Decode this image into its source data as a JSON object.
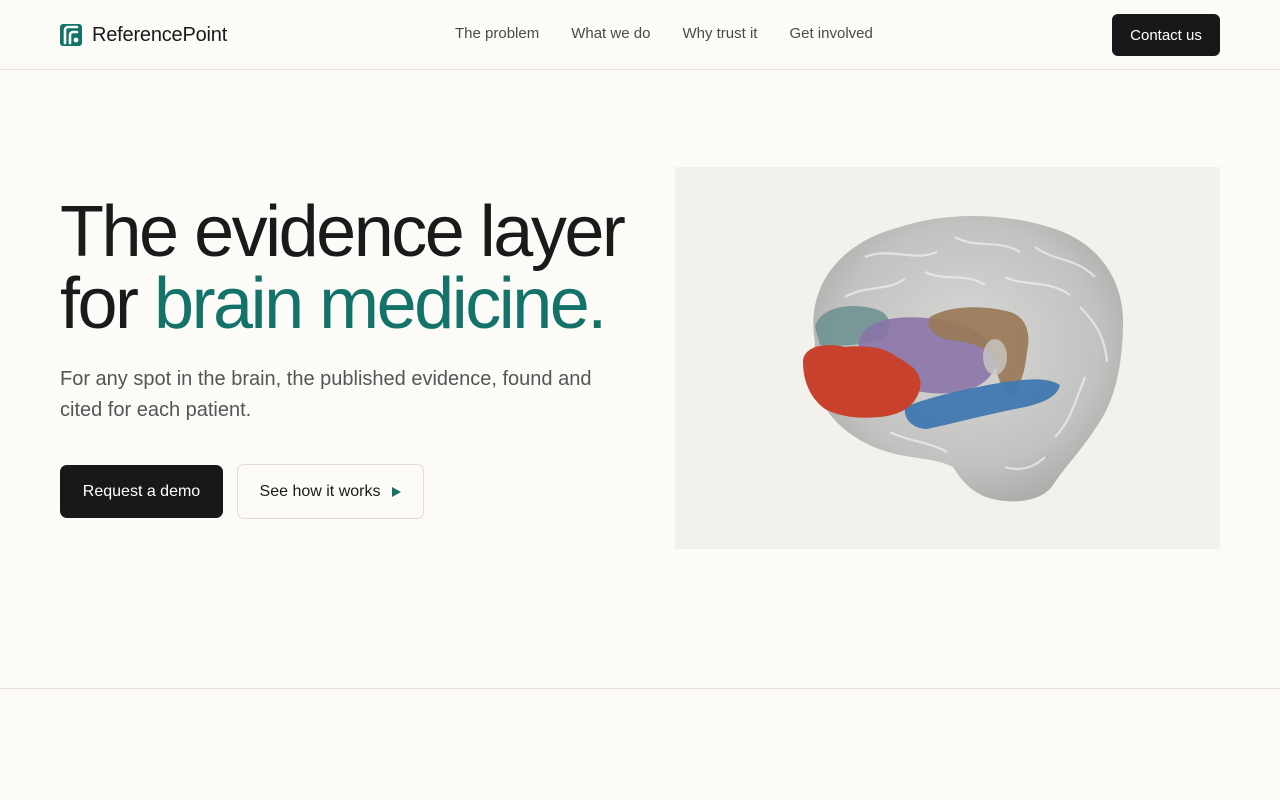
{
  "header": {
    "brand_name": "ReferencePoint",
    "nav": [
      "The problem",
      "What we do",
      "Why trust it",
      "Get involved"
    ],
    "contact_label": "Contact us"
  },
  "hero": {
    "title_line1": "The evidence layer",
    "title_for": "for ",
    "title_accent": "brain medicine.",
    "subtitle": "For any spot in the brain, the published evidence, found and cited for each patient.",
    "primary_label": "Request a demo",
    "secondary_label": "See how it works"
  },
  "icons": {
    "logo": "referencepoint-logo-icon",
    "play": "play-icon"
  },
  "colors": {
    "accent": "#137369",
    "button_dark": "#17181a",
    "background": "#fdfbf8",
    "panel": "#f3f1ec",
    "region_red": "#c8412c",
    "region_purple": "#8a74a8",
    "region_brown": "#9a7a58",
    "region_blue": "#3f78b0",
    "region_teal": "#5f8a8a"
  }
}
